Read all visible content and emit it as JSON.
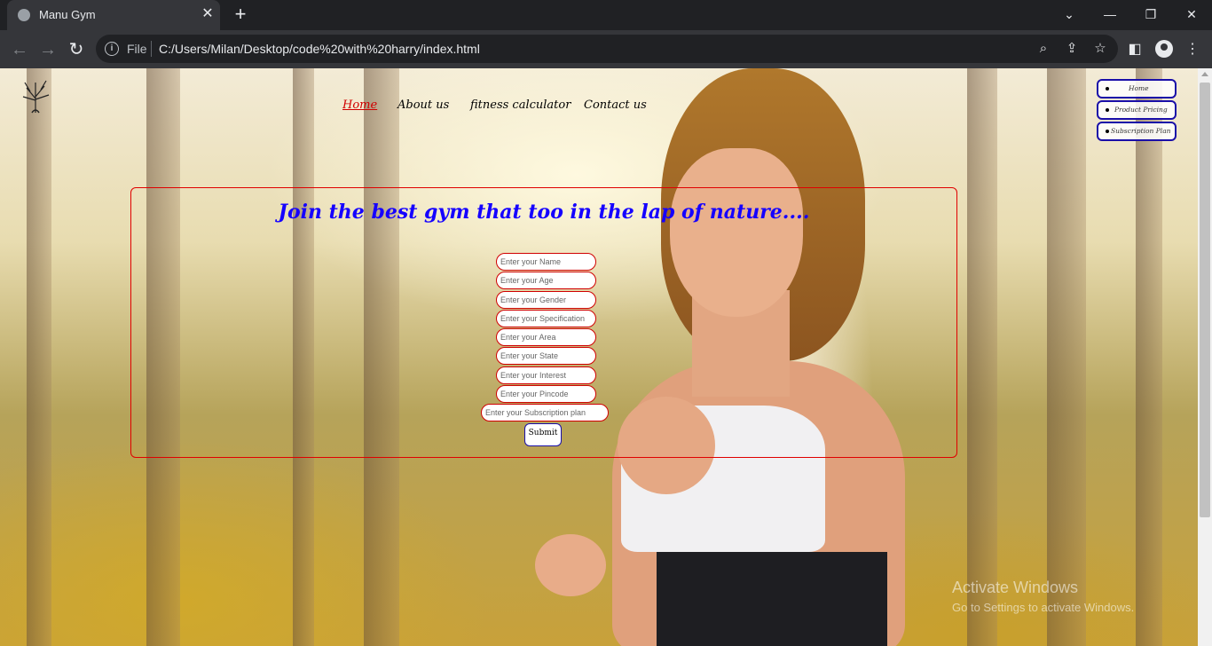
{
  "browser": {
    "tab_title": "Manu Gym",
    "tab_close": "✕",
    "new_tab": "+",
    "window_controls": {
      "chevron": "⌄",
      "minimize": "—",
      "restore": "❐",
      "close": "✕"
    },
    "scheme_label": "File",
    "url": "C:/Users/Milan/Desktop/code%20with%20harry/index.html",
    "icons": [
      "back-arrow-icon",
      "forward-arrow-icon",
      "reload-icon",
      "info-icon",
      "zoom-icon",
      "share-icon",
      "bookmark-star-icon",
      "side-panel-icon",
      "profile-icon",
      "menu-kebab-icon"
    ]
  },
  "page": {
    "nav": [
      {
        "label": "Home",
        "active": true
      },
      {
        "label": "About us",
        "active": false
      },
      {
        "label": "fitness calculator",
        "active": false
      },
      {
        "label": "Contact us",
        "active": false
      }
    ],
    "side_menu": [
      "Home",
      "Product Pricing",
      "Subscription Plan"
    ],
    "heading": "Join the best gym that too in the lap of nature....",
    "fields": [
      "Enter your Name",
      "Enter your Age",
      "Enter your Gender",
      "Enter your Specification",
      "Enter your Area",
      "Enter your State",
      "Enter your Interest",
      "Enter your Pincode",
      "Enter your Subscription plan"
    ],
    "submit_label": "Submit"
  },
  "os_overlay": {
    "title": "Activate Windows",
    "subtitle": "Go to Settings to activate Windows."
  },
  "colors": {
    "accent_red": "#d00000",
    "heading_blue": "#1500ff",
    "button_border": "#1a0fa8"
  }
}
